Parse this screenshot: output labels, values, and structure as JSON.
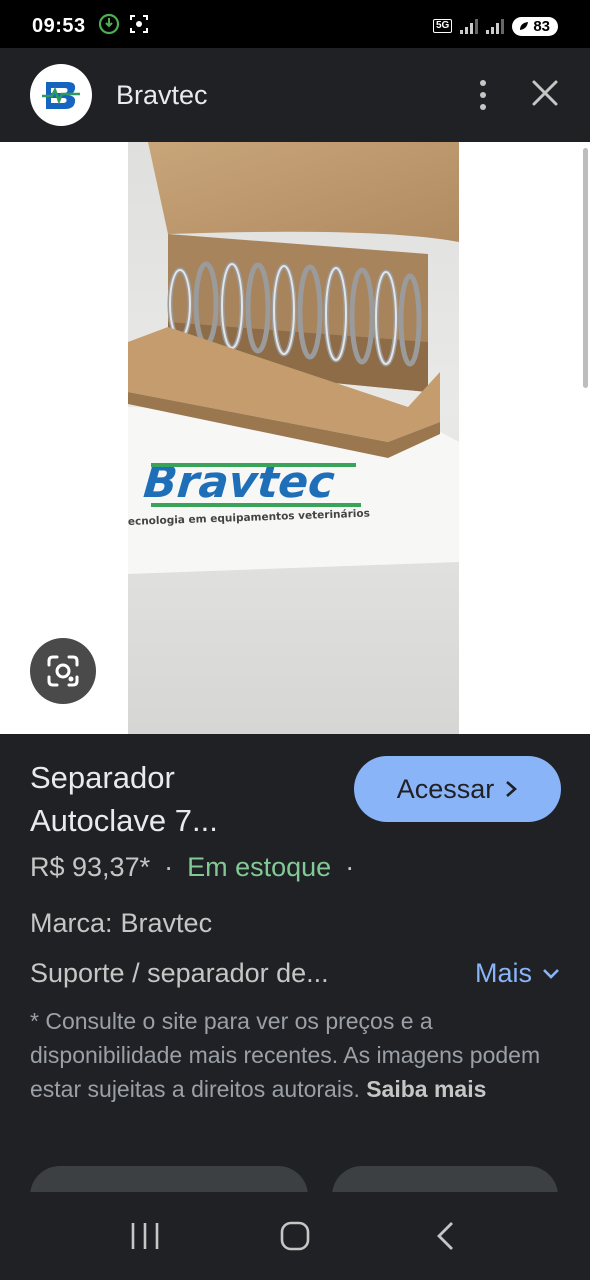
{
  "status_bar": {
    "time": "09:53",
    "network": "5G",
    "battery": "83",
    "left_icons": [
      "app-notification-icon",
      "screenshot-icon"
    ],
    "right_icons": [
      "5g-icon",
      "signal-icon",
      "signal-icon",
      "battery-icon"
    ]
  },
  "header": {
    "site_name": "Bravtec",
    "logo_text": "B",
    "menu_icon": "kebab-menu-icon",
    "close_icon": "close-icon"
  },
  "image": {
    "alt": "Bravtec",
    "photo_caption": "ecnologia em equipamentos veterinários",
    "lens_icon": "google-lens-icon"
  },
  "product": {
    "title_line1": "Separador",
    "title_line2": "Autoclave 7...",
    "access_label": "Acessar",
    "price": "R$ 93,37*",
    "stock": "Em estoque",
    "brand_label": "Marca:",
    "brand_value": "Bravtec",
    "description": "Suporte / separador de...",
    "more_label": "Mais",
    "disclaimer": "* Consulte o site para ver os preços e a disponibilidade mais recentes. As imagens podem estar sujeitas a direitos autorais.",
    "learn_more": "Saiba mais"
  },
  "colors": {
    "accent": "#8ab4f8",
    "stock_green": "#81c995",
    "background": "#202124",
    "brand_blue": "#1565c0",
    "brand_green": "#2e9a5c"
  }
}
